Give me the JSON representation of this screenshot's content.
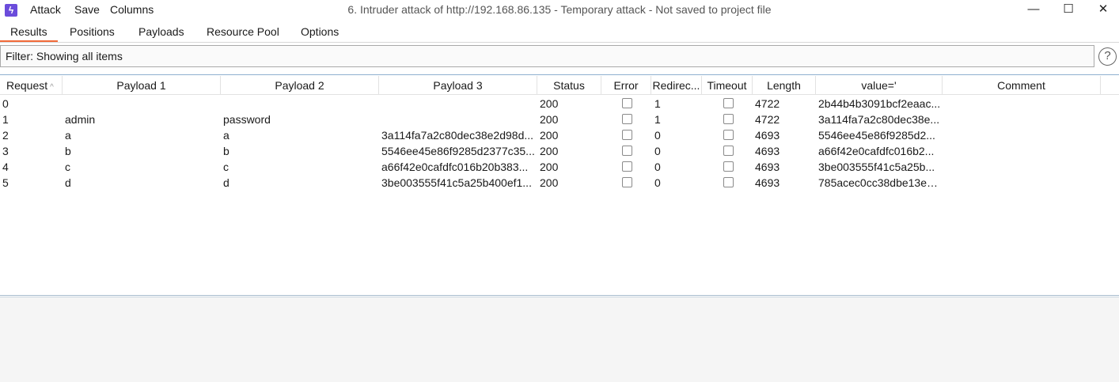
{
  "app_icon": "lightning-bolt-icon",
  "menu": [
    "Attack",
    "Save",
    "Columns"
  ],
  "window_title": "6. Intruder attack of http://192.168.86.135 - Temporary attack - Not saved to project file",
  "window_controls": {
    "minimize": "—",
    "maximize": "☐",
    "close": "✕"
  },
  "tabs": [
    "Results",
    "Positions",
    "Payloads",
    "Resource Pool",
    "Options"
  ],
  "active_tab": "Results",
  "accent_color": "#f26b3a",
  "filter": {
    "text": "Filter: Showing all items"
  },
  "help_label": "?",
  "columns": [
    "Request",
    "Payload 1",
    "Payload 2",
    "Payload 3",
    "Status",
    "Error",
    "Redirec...",
    "Timeout",
    "Length",
    "value='",
    "Comment"
  ],
  "sort_indicator": "^",
  "rows": [
    {
      "request": "0",
      "payload1": "",
      "payload2": "",
      "payload3": "",
      "status": "200",
      "error": false,
      "redirects": "1",
      "timeout": false,
      "length": "4722",
      "value": "2b44b4b3091bcf2eaac...",
      "comment": ""
    },
    {
      "request": "1",
      "payload1": "admin",
      "payload2": "password",
      "payload3": "",
      "status": "200",
      "error": false,
      "redirects": "1",
      "timeout": false,
      "length": "4722",
      "value": "3a114fa7a2c80dec38e...",
      "comment": ""
    },
    {
      "request": "2",
      "payload1": "a",
      "payload2": "a",
      "payload3": "3a114fa7a2c80dec38e2d98d...",
      "status": "200",
      "error": false,
      "redirects": "0",
      "timeout": false,
      "length": "4693",
      "value": "5546ee45e86f9285d2...",
      "comment": ""
    },
    {
      "request": "3",
      "payload1": "b",
      "payload2": "b",
      "payload3": "5546ee45e86f9285d2377c35...",
      "status": "200",
      "error": false,
      "redirects": "0",
      "timeout": false,
      "length": "4693",
      "value": "a66f42e0cafdfc016b2...",
      "comment": ""
    },
    {
      "request": "4",
      "payload1": "c",
      "payload2": "c",
      "payload3": "a66f42e0cafdfc016b20b383...",
      "status": "200",
      "error": false,
      "redirects": "0",
      "timeout": false,
      "length": "4693",
      "value": "3be003555f41c5a25b...",
      "comment": ""
    },
    {
      "request": "5",
      "payload1": "d",
      "payload2": "d",
      "payload3": "3be003555f41c5a25b400ef1...",
      "status": "200",
      "error": false,
      "redirects": "0",
      "timeout": false,
      "length": "4693",
      "value": "785acec0cc38dbe13e0...",
      "comment": ""
    }
  ]
}
